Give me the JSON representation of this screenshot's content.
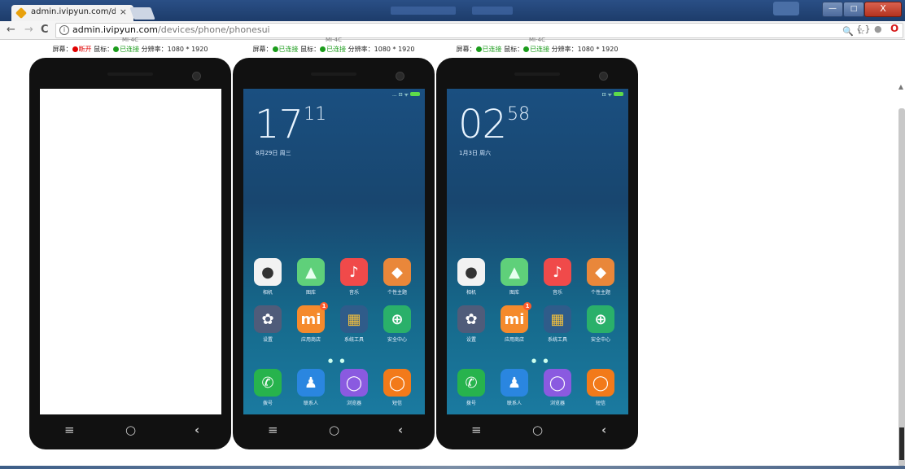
{
  "browser": {
    "tab_title": "admin.ivipyun.com/de",
    "tab_close": "×",
    "url_host": "admin.ivipyun.com",
    "url_path": "/devices/phone/phonesui",
    "back": "←",
    "forward": "→",
    "reload": "C",
    "info": "i",
    "zoom_icon": "🔍",
    "star": "☆",
    "ext1": "{ }",
    "ext2": "●",
    "opera": "O",
    "win_min": "—",
    "win_max": "□",
    "win_close": "X"
  },
  "devices": [
    {
      "model": "MI-4C",
      "screen_label": "屏幕：",
      "screen_status": "断开",
      "mouse_label": " 鼠标：",
      "mouse_status": "已连接",
      "resolution": " 分辨率：1080 * 1920",
      "screen_on": false
    },
    {
      "model": "MI-4C",
      "screen_label": "屏幕：",
      "screen_status": "已连接",
      "mouse_label": " 鼠标：",
      "mouse_status": "已连接",
      "resolution": " 分辨率：1080 * 1920",
      "screen_on": true,
      "clock_hh": "17",
      "clock_mm": "11",
      "date": "8月29日 周三",
      "status_icons": "... ⊡ ᯤ"
    },
    {
      "model": "MI-4C",
      "screen_label": "屏幕：",
      "screen_status": "已连接",
      "mouse_label": " 鼠标：",
      "mouse_status": "已连接",
      "resolution": " 分辨率：1080 * 1920",
      "screen_on": true,
      "clock_hh": "02",
      "clock_mm": "58",
      "date": "1月3日 周六",
      "status_icons": "⊡ ᯤ"
    }
  ],
  "apps": [
    {
      "label": "相机",
      "icon": "camera-icon",
      "glyph": "●",
      "color": "#f2f2f2",
      "fg": "#333"
    },
    {
      "label": "图库",
      "icon": "gallery-icon",
      "glyph": "▲",
      "color": "#5fd07a",
      "fg": "#e8fff0"
    },
    {
      "label": "音乐",
      "icon": "music-icon",
      "glyph": "♪",
      "color": "#f04a4a",
      "fg": "#fff"
    },
    {
      "label": "个性主题",
      "icon": "theme-icon",
      "glyph": "◆",
      "color": "#e9873a",
      "fg": "#fff"
    },
    {
      "label": "设置",
      "icon": "settings-icon",
      "glyph": "✿",
      "color": "#4f5c7a",
      "fg": "#fff"
    },
    {
      "label": "应用商店",
      "icon": "app-store-icon",
      "glyph": "mi",
      "color": "#f58a2c",
      "fg": "#fff",
      "badge": "1"
    },
    {
      "label": "系统工具",
      "icon": "system-tools-icon",
      "glyph": "▦",
      "color": "#2f5c8a",
      "fg": "#f6c13b"
    },
    {
      "label": "安全中心",
      "icon": "security-icon",
      "glyph": "⊕",
      "color": "#2ab06a",
      "fg": "#fff"
    },
    {
      "label": "拨号",
      "icon": "phone-icon",
      "glyph": "✆",
      "color": "#27b34d",
      "fg": "#fff"
    },
    {
      "label": "联系人",
      "icon": "contacts-icon",
      "glyph": "♟",
      "color": "#2a86e0",
      "fg": "#fff"
    },
    {
      "label": "浏览器",
      "icon": "browser-icon",
      "glyph": "◯",
      "color": "#8a5ae0",
      "fg": "#fff"
    },
    {
      "label": "短信",
      "icon": "messages-icon",
      "glyph": "◯",
      "color": "#f27a1a",
      "fg": "#fff"
    }
  ],
  "page_dots": "● ●",
  "nav": {
    "menu": "≡",
    "home": "○",
    "back": "‹"
  },
  "colors": {
    "disconnected": "#e00000",
    "connected": "#1c9c1c",
    "frame": "#111111"
  }
}
